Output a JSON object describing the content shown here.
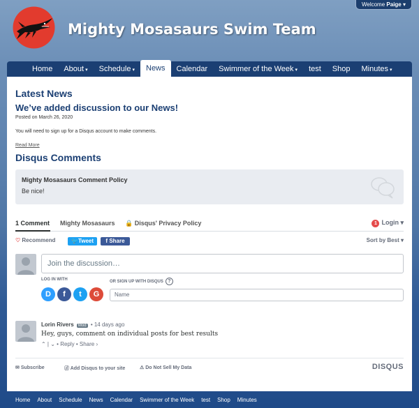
{
  "header": {
    "welcome": {
      "prefix": "Welcome",
      "user": "Paige",
      "caret": "▾"
    },
    "logo": {
      "name": "mosasaur-logo",
      "color": "#e23b2e"
    },
    "site_title": "Mighty Mosasaurs Swim Team"
  },
  "nav": {
    "items": [
      {
        "label": "Home",
        "dropdown": false
      },
      {
        "label": "About",
        "dropdown": true
      },
      {
        "label": "Schedule",
        "dropdown": true
      },
      {
        "label": "News",
        "dropdown": false,
        "active": true
      },
      {
        "label": "Calendar",
        "dropdown": false
      },
      {
        "label": "Swimmer of the Week",
        "dropdown": true
      },
      {
        "label": "test",
        "dropdown": false
      },
      {
        "label": "Shop",
        "dropdown": false
      },
      {
        "label": "Minutes",
        "dropdown": true
      }
    ],
    "caret": "▾"
  },
  "main": {
    "heading": "Latest News",
    "post": {
      "title": "We’ve added discussion to our News!",
      "posted": "Posted on March 26, 2020",
      "text": "You will need to sign up for a Disqus account to make comments.",
      "read_more": "Read More"
    },
    "disqus_heading": "Disqus Comments"
  },
  "disqus": {
    "policy": {
      "title": "Mighty Mosasaurs Comment Policy",
      "text": "Be nice!"
    },
    "tabs": {
      "comments": "1 Comment",
      "community": "Mighty Mosasaurs",
      "privacy": "Disqus' Privacy Policy"
    },
    "login": {
      "count": "1",
      "label": "Login"
    },
    "recommend": "Recommend",
    "tweet": "Tweet",
    "share": "Share",
    "sort": "Sort by Best",
    "join_placeholder": "Join the discussion…",
    "login_with": "LOG IN WITH",
    "signup_with": "OR SIGN UP WITH DISQUS",
    "name_placeholder": "Name",
    "social": [
      {
        "letter": "D",
        "color": "#2e9fff"
      },
      {
        "letter": "f",
        "color": "#3b5998"
      },
      {
        "letter": "t",
        "color": "#1da1f2"
      },
      {
        "letter": "G",
        "color": "#dd4b39"
      }
    ],
    "comment": {
      "author": "Lorin Rivers",
      "badge": "Mod",
      "time": "14 days ago",
      "body": "Hey, guys, comment on individual posts for best results",
      "reply": "Reply",
      "share": "Share ›"
    },
    "footer": {
      "subscribe": "Subscribe",
      "add": "Add Disqus to your site",
      "dnsmpi": "Do Not Sell My Data",
      "brand": "DISQUS"
    }
  },
  "bottom_nav": [
    "Home",
    "About",
    "Schedule",
    "News",
    "Calendar",
    "Swimmer of the Week",
    "test",
    "Shop",
    "Minutes"
  ]
}
